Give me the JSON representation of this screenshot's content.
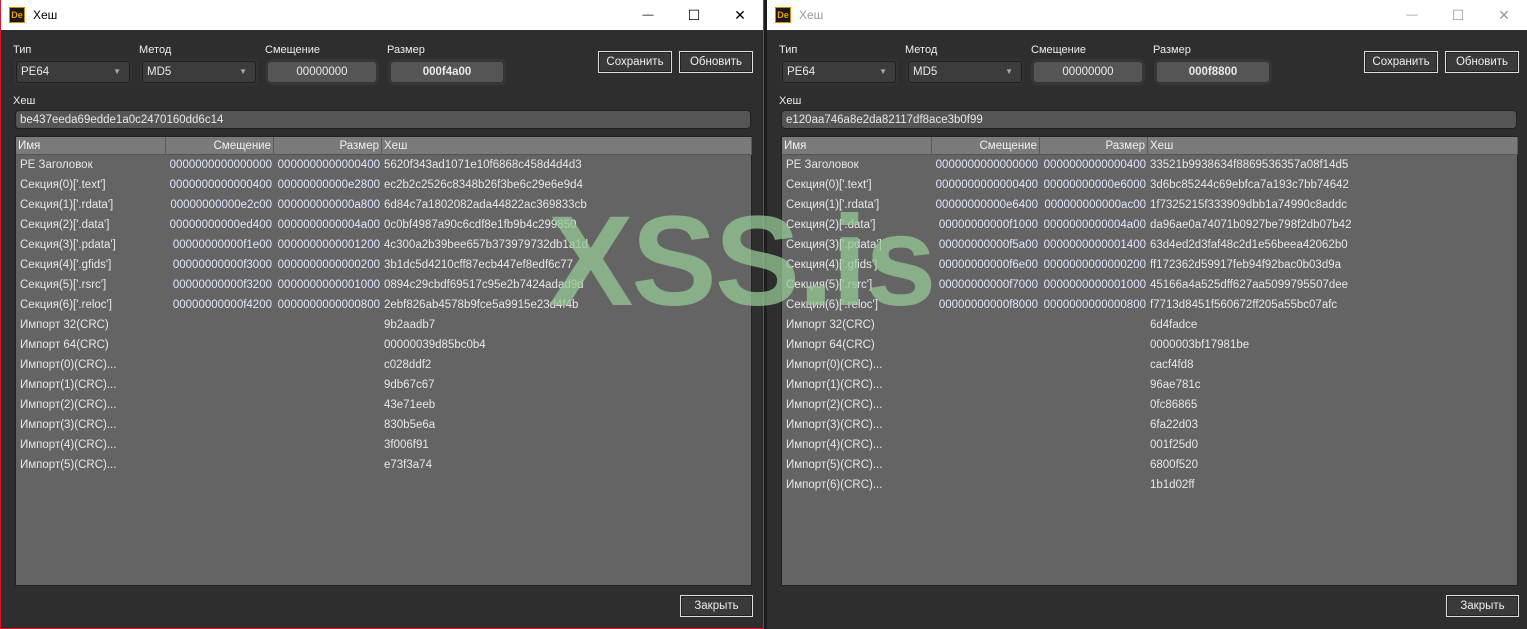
{
  "windows": [
    {
      "title": "Хеш",
      "active": true,
      "labels": {
        "type": "Тип",
        "method": "Метод",
        "offset": "Смещение",
        "size": "Размер",
        "hash": "Хеш"
      },
      "type_value": "PE64",
      "method_value": "MD5",
      "offset_value": "00000000",
      "size_value": "000f4a00",
      "save_label": "Сохранить",
      "refresh_label": "Обновить",
      "close_label": "Закрыть",
      "hash_value": "be437eeda69edde1a0c2470160dd6c14",
      "columns": [
        "Имя",
        "Смещение",
        "Размер",
        "Хеш"
      ],
      "rows": [
        [
          "PE Заголовок",
          "0000000000000000",
          "0000000000000400",
          "5620f343ad1071e10f6868c458d4d4d3"
        ],
        [
          "Секция(0)['.text']",
          "0000000000000400",
          "00000000000e2800",
          "ec2b2c2526c8348b26f3be6c29e6e9d4"
        ],
        [
          "Секция(1)['.rdata']",
          "00000000000e2c00",
          "000000000000a800",
          "6d84c7a1802082ada44822ac369833cb"
        ],
        [
          "Секция(2)['.data']",
          "00000000000ed400",
          "0000000000004a00",
          "0c0bf4987a90c6cdf8e1fb9b4c299850"
        ],
        [
          "Секция(3)['.pdata']",
          "00000000000f1e00",
          "0000000000001200",
          "4c300a2b39bee657b373979732db1a1d"
        ],
        [
          "Секция(4)['.gfids']",
          "00000000000f3000",
          "0000000000000200",
          "3b1dc5d4210cff87ecb447ef8edf6c77"
        ],
        [
          "Секция(5)['.rsrc']",
          "00000000000f3200",
          "0000000000001000",
          "0894c29cbdf69517c95e2b7424adad9d"
        ],
        [
          "Секция(6)['.reloc']",
          "00000000000f4200",
          "0000000000000800",
          "2ebf826ab4578b9fce5a9915e23d4f4b"
        ],
        [
          "Импорт 32(CRC)",
          "",
          "",
          "9b2aadb7"
        ],
        [
          "Импорт 64(CRC)",
          "",
          "",
          "00000039d85bc0b4"
        ],
        [
          "Импорт(0)(CRC)...",
          "",
          "",
          "c028ddf2"
        ],
        [
          "Импорт(1)(CRC)...",
          "",
          "",
          "9db67c67"
        ],
        [
          "Импорт(2)(CRC)...",
          "",
          "",
          "43e71eeb"
        ],
        [
          "Импорт(3)(CRC)...",
          "",
          "",
          "830b5e6a"
        ],
        [
          "Импорт(4)(CRC)...",
          "",
          "",
          "3f006f91"
        ],
        [
          "Импорт(5)(CRC)...",
          "",
          "",
          "e73f3a74"
        ]
      ]
    },
    {
      "title": "Хеш",
      "active": false,
      "labels": {
        "type": "Тип",
        "method": "Метод",
        "offset": "Смещение",
        "size": "Размер",
        "hash": "Хеш"
      },
      "type_value": "PE64",
      "method_value": "MD5",
      "offset_value": "00000000",
      "size_value": "000f8800",
      "save_label": "Сохранить",
      "refresh_label": "Обновить",
      "close_label": "Закрыть",
      "hash_value": "e120aa746a8e2da82117df8ace3b0f99",
      "columns": [
        "Имя",
        "Смещение",
        "Размер",
        "Хеш"
      ],
      "rows": [
        [
          "PE Заголовок",
          "0000000000000000",
          "0000000000000400",
          "33521b9938634f8869536357a08f14d5"
        ],
        [
          "Секция(0)['.text']",
          "0000000000000400",
          "00000000000e6000",
          "3d6bc85244c69ebfca7a193c7bb74642"
        ],
        [
          "Секция(1)['.rdata']",
          "00000000000e6400",
          "000000000000ac00",
          "1f7325215f333909dbb1a74990c8addc"
        ],
        [
          "Секция(2)['.data']",
          "00000000000f1000",
          "0000000000004a00",
          "da96ae0a74071b0927be798f2db07b42"
        ],
        [
          "Секция(3)['.pdata']",
          "00000000000f5a00",
          "0000000000001400",
          "63d4ed2d3faf48c2d1e56beea42062b0"
        ],
        [
          "Секция(4)['.gfids']",
          "00000000000f6e00",
          "0000000000000200",
          "ff172362d59917feb94f92bac0b03d9a"
        ],
        [
          "Секция(5)['.rsrc']",
          "00000000000f7000",
          "0000000000001000",
          "45166a4a525dff627aa5099795507dee"
        ],
        [
          "Секция(6)['.reloc']",
          "00000000000f8000",
          "0000000000000800",
          "f7713d8451f560672ff205a55bc07afc"
        ],
        [
          "Импорт 32(CRC)",
          "",
          "",
          "6d4fadce"
        ],
        [
          "Импорт 64(CRC)",
          "",
          "",
          "0000003bf17981be"
        ],
        [
          "Импорт(0)(CRC)...",
          "",
          "",
          "cacf4fd8"
        ],
        [
          "Импорт(1)(CRC)...",
          "",
          "",
          "96ae781c"
        ],
        [
          "Импорт(2)(CRC)...",
          "",
          "",
          "0fc86865"
        ],
        [
          "Импорт(3)(CRC)...",
          "",
          "",
          "6fa22d03"
        ],
        [
          "Импорт(4)(CRC)...",
          "",
          "",
          "001f25d0"
        ],
        [
          "Импорт(5)(CRC)...",
          "",
          "",
          "6800f520"
        ],
        [
          "Импорт(6)(CRC)...",
          "",
          "",
          "1b1d02ff"
        ]
      ]
    }
  ],
  "watermark": "XSS.is",
  "colors": {
    "active_border": "#e81123",
    "table_bg": "#646464",
    "body_bg": "#2e2e2e"
  }
}
